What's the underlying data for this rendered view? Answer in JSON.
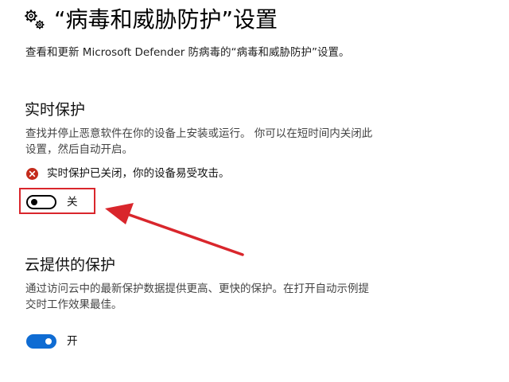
{
  "header": {
    "icon": "settings-gears-icon",
    "title": "“病毒和威胁防护”设置"
  },
  "subtitle": "查看和更新 Microsoft Defender 防病毒的“病毒和威胁防护”设置。",
  "realtime": {
    "title": "实时保护",
    "desc_line1": "查找并停止恶意软件在你的设备上安装或运行。 你可以在短时间内关闭此",
    "desc_line2": "设置，然后自动开启。",
    "warning_icon": "error-icon",
    "warning": "实时保护已关闭，你的设备易受攻击。",
    "toggle_state": "off",
    "toggle_label": "关"
  },
  "cloud": {
    "title": "云提供的保护",
    "desc_line1": "通过访问云中的最新保护数据提供更高、更快的保护。在打开自动示例提",
    "desc_line2": "交时工作效果最佳。",
    "toggle_state": "on",
    "toggle_label": "开"
  },
  "colors": {
    "annotation_red": "#d9262c",
    "toggle_on_blue": "#0f6cd3",
    "error_red": "#c42b1c"
  }
}
